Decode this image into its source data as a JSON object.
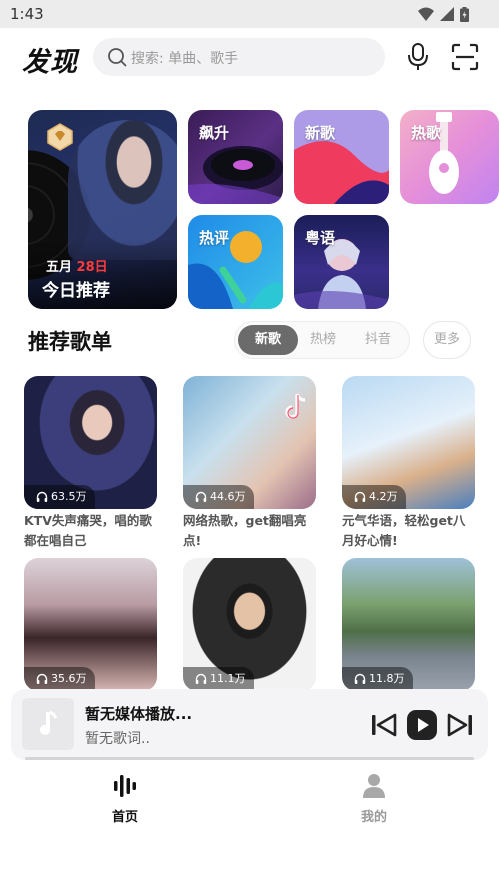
{
  "status_bar": {
    "time": "1:43"
  },
  "header": {
    "logo": "发现",
    "search_placeholder": "搜索: 单曲、歌手"
  },
  "featured": {
    "big": {
      "date_prefix": "五月",
      "date_day": "28日",
      "title": "今日推荐"
    },
    "tiles": {
      "soar": "飙升",
      "new": "新歌",
      "hot": "热歌",
      "comment": "热评",
      "cantonese": "粤语"
    }
  },
  "playlist_section": {
    "title": "推荐歌单",
    "tabs": [
      "新歌",
      "热榜",
      "抖音"
    ],
    "active_tab": 0,
    "more": "更多",
    "cards": [
      {
        "count": "63.5万",
        "title": "KTV失声痛哭，唱的歌都在唱自己"
      },
      {
        "count": "44.6万",
        "title": "网络热歌，get翻唱亮点!"
      },
      {
        "count": "4.2万",
        "title": "元气华语，轻松get八月好心情!"
      },
      {
        "count": "35.6万",
        "title": ""
      },
      {
        "count": "11.1万",
        "title": ""
      },
      {
        "count": "11.8万",
        "title": ""
      }
    ]
  },
  "player": {
    "title": "暂无媒体播放...",
    "subtitle": "暂无歌词..",
    "progress": 0
  },
  "bottom_nav": {
    "home": "首页",
    "mine": "我的"
  },
  "colors": {
    "accent_red": "#ff3b3b",
    "active_tab_bg": "#6b6b6b",
    "nav_inactive": "#9a9a9a"
  }
}
